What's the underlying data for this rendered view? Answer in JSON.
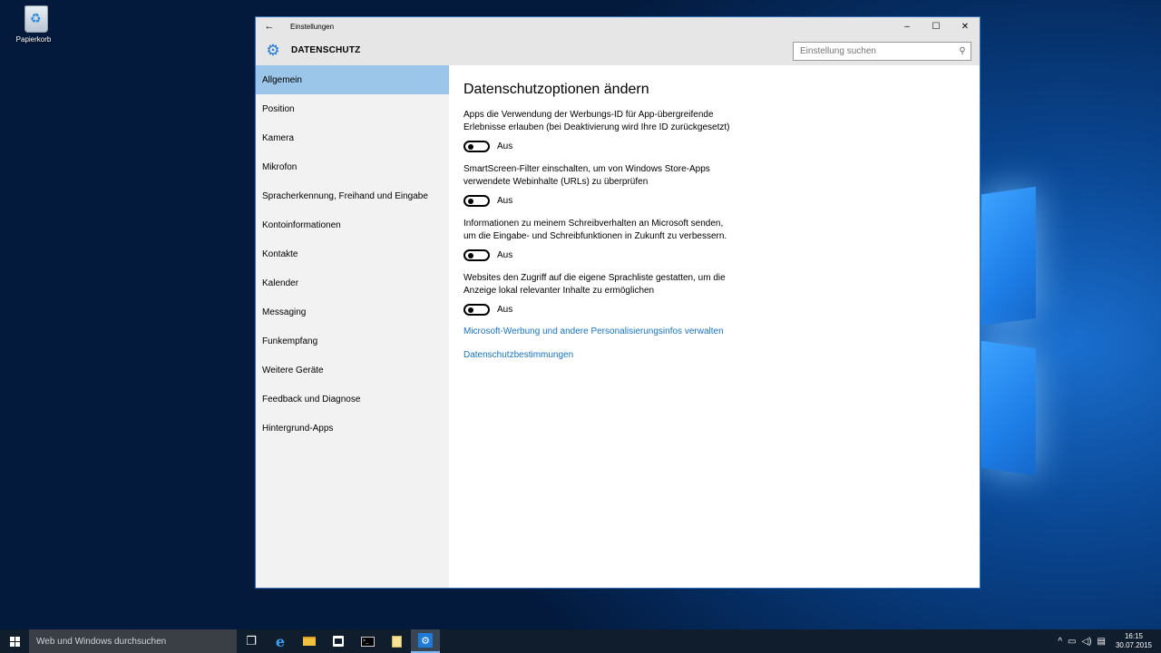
{
  "desktop": {
    "recycle_bin_label": "Papierkorb"
  },
  "window": {
    "title": "Einstellungen",
    "back_glyph": "←",
    "minimize_glyph": "–",
    "maximize_glyph": "☐",
    "close_glyph": "✕",
    "section_title": "DATENSCHUTZ",
    "search_placeholder": "Einstellung suchen"
  },
  "sidebar": {
    "items": [
      {
        "label": "Allgemein",
        "active": true
      },
      {
        "label": "Position"
      },
      {
        "label": "Kamera"
      },
      {
        "label": "Mikrofon"
      },
      {
        "label": "Spracherkennung, Freihand und Eingabe"
      },
      {
        "label": "Kontoinformationen"
      },
      {
        "label": "Kontakte"
      },
      {
        "label": "Kalender"
      },
      {
        "label": "Messaging"
      },
      {
        "label": "Funkempfang"
      },
      {
        "label": "Weitere Geräte"
      },
      {
        "label": "Feedback und Diagnose"
      },
      {
        "label": "Hintergrund-Apps"
      }
    ]
  },
  "content": {
    "heading": "Datenschutzoptionen ändern",
    "settings": [
      {
        "desc": "Apps die Verwendung der Werbungs-ID für App-übergreifende Erlebnisse erlauben (bei Deaktivierung wird Ihre ID zurückgesetzt)",
        "state": "Aus",
        "on": false
      },
      {
        "desc": "SmartScreen-Filter einschalten, um von Windows Store-Apps verwendete Webinhalte (URLs) zu überprüfen",
        "state": "Aus",
        "on": false
      },
      {
        "desc": "Informationen zu meinem Schreibverhalten an Microsoft senden, um die Eingabe- und Schreibfunktionen in Zukunft zu verbessern.",
        "state": "Aus",
        "on": false
      },
      {
        "desc": "Websites den Zugriff auf die eigene Sprachliste gestatten, um die Anzeige lokal relevanter Inhalte zu ermöglichen",
        "state": "Aus",
        "on": false
      }
    ],
    "links": [
      "Microsoft-Werbung und andere Personalisierungsinfos verwalten",
      "Datenschutzbestimmungen"
    ]
  },
  "taskbar": {
    "search_placeholder": "Web und Windows durchsuchen",
    "icons": [
      "task-view-icon",
      "edge-icon",
      "file-explorer-icon",
      "store-icon",
      "command-prompt-icon",
      "notepad-icon",
      "settings-icon"
    ],
    "clock_time": "16:15",
    "clock_date": "30.07.2015"
  }
}
